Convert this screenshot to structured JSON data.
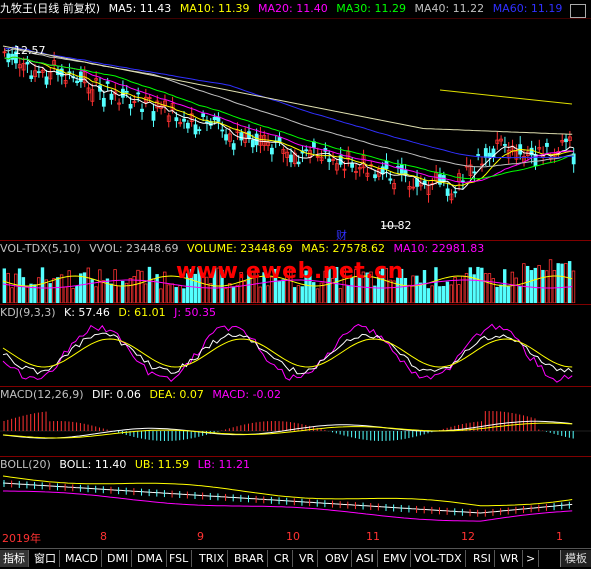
{
  "main_header": {
    "title": "九牧王(日线 前复权)",
    "ma": [
      {
        "label": "MA5: 11.43",
        "color": "#ffffff"
      },
      {
        "label": "MA10: 11.39",
        "color": "#ffff00"
      },
      {
        "label": "MA20: 11.40",
        "color": "#ff00ff"
      },
      {
        "label": "MA30: 11.29",
        "color": "#00ff00"
      },
      {
        "label": "MA40: 11.22",
        "color": "#c0c0c0"
      },
      {
        "label": "MA60: 11.19",
        "color": "#3030ff"
      }
    ]
  },
  "price_annotations": {
    "high": "12.57",
    "low": "10.82",
    "event": "财"
  },
  "vol_header": {
    "items": [
      {
        "label": "VOL-TDX(5,10)",
        "color": "#c0c0c0"
      },
      {
        "label": "VVOL: 23448.69",
        "color": "#c0c0c0"
      },
      {
        "label": "VOLUME: 23448.69",
        "color": "#ffff00"
      },
      {
        "label": "MA5: 27578.62",
        "color": "#ffff00"
      },
      {
        "label": "MA10: 22981.83",
        "color": "#ff00ff"
      }
    ]
  },
  "kdj_header": {
    "items": [
      {
        "label": "KDJ(9,3,3)",
        "color": "#c0c0c0"
      },
      {
        "label": "K: 57.46",
        "color": "#ffffff"
      },
      {
        "label": "D: 61.01",
        "color": "#ffff00"
      },
      {
        "label": "J: 50.35",
        "color": "#ff00ff"
      }
    ]
  },
  "macd_header": {
    "items": [
      {
        "label": "MACD(12,26,9)",
        "color": "#c0c0c0"
      },
      {
        "label": "DIF: 0.06",
        "color": "#ffffff"
      },
      {
        "label": "DEA: 0.07",
        "color": "#ffff00"
      },
      {
        "label": "MACD: -0.02",
        "color": "#ff00ff"
      }
    ]
  },
  "boll_header": {
    "items": [
      {
        "label": "BOLL(20)",
        "color": "#c0c0c0"
      },
      {
        "label": "BOLL: 11.40",
        "color": "#ffffff"
      },
      {
        "label": "UB: 11.59",
        "color": "#ffff00"
      },
      {
        "label": "LB: 11.21",
        "color": "#ff00ff"
      }
    ]
  },
  "watermark": "www.eweb.net.cn",
  "time_axis": [
    "2019年",
    "8",
    "9",
    "10",
    "11",
    "12",
    "1"
  ],
  "bottom_tabs": [
    "指标",
    "窗口",
    "MACD",
    "DMI",
    "DMA",
    "FSL",
    "TRIX",
    "BRAR",
    "CR",
    "VR",
    "OBV",
    "ASI",
    "EMV",
    "VOL-TDX",
    "RSI",
    "WR",
    ">"
  ],
  "template_button": "模板",
  "colors": {
    "up": "#ff3232",
    "down": "#54ffff",
    "frame": "#800000"
  }
}
